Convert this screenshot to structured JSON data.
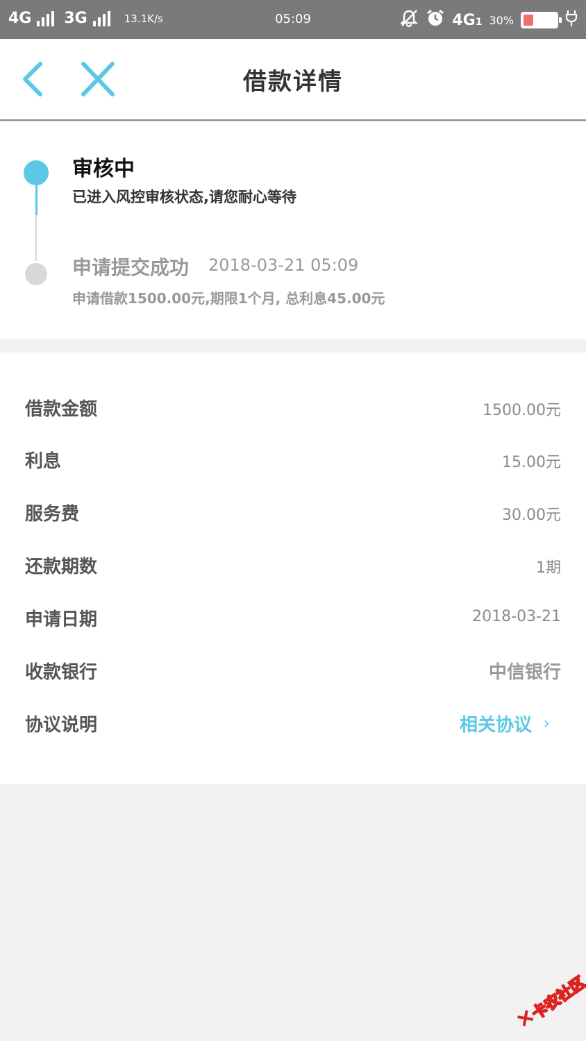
{
  "status_bar": {
    "net1": "4G",
    "net2": "3G",
    "speed": "13.1K/s",
    "time": "05:09",
    "mute_icon": "bell-off-icon",
    "alarm_icon": "alarm-clock-icon",
    "net3": "4G",
    "sim_index": "1",
    "battery_text": "30%",
    "battery_level": 0.3,
    "colors": {
      "background": "#7a7a7a",
      "battery_low": "#f26d6d"
    }
  },
  "header": {
    "title": "借款详情",
    "back_icon": "chevron-left-icon",
    "close_icon": "close-icon",
    "accent": "#5bc8e6"
  },
  "timeline": {
    "steps": [
      {
        "title": "审核中",
        "desc": "已进入风控审核状态,请您耐心等待",
        "status": "active"
      },
      {
        "title": "申请提交成功",
        "time": "2018-03-21  05:09",
        "desc": "申请借款1500.00元,期限1个月, 总利息45.00元",
        "status": "done"
      }
    ]
  },
  "details": {
    "rows": [
      {
        "label": "借款金额",
        "value": "1500.00元"
      },
      {
        "label": "利息",
        "value": "15.00元"
      },
      {
        "label": "服务费",
        "value": "30.00元"
      },
      {
        "label": "还款期数",
        "value": "1期"
      },
      {
        "label": "申请日期",
        "value": "2018-03-21"
      },
      {
        "label": "收款银行",
        "value": "中信银行"
      },
      {
        "label": "协议说明",
        "value": "相关协议",
        "chevron": "›"
      }
    ]
  },
  "watermark": {
    "text": "卡农社区"
  }
}
